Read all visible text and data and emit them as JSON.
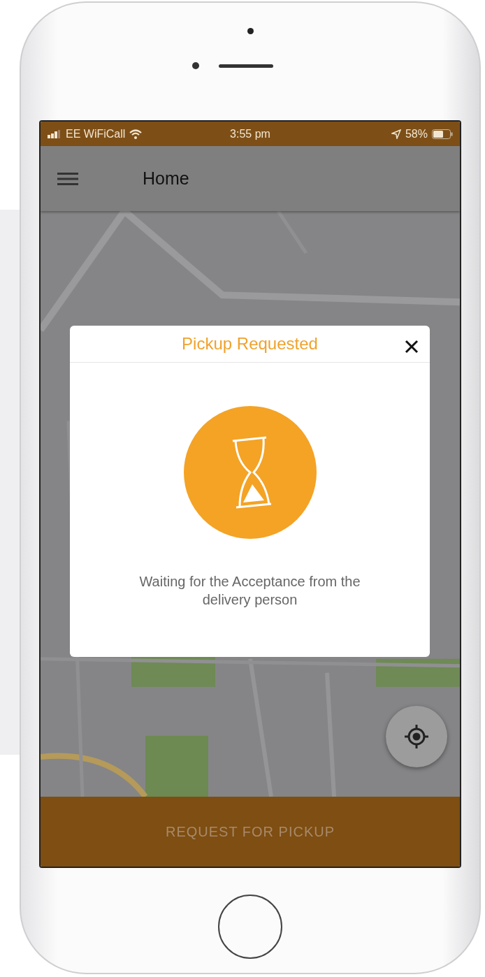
{
  "status_bar": {
    "carrier": "EE WiFiCall",
    "time": "3:55 pm",
    "battery": "58%"
  },
  "app_bar": {
    "title": "Home"
  },
  "dialog": {
    "title": "Pickup Requested",
    "message": "Waiting for the Acceptance from the delivery person"
  },
  "bottom_button": {
    "label": "REQUEST FOR PICKUP"
  }
}
